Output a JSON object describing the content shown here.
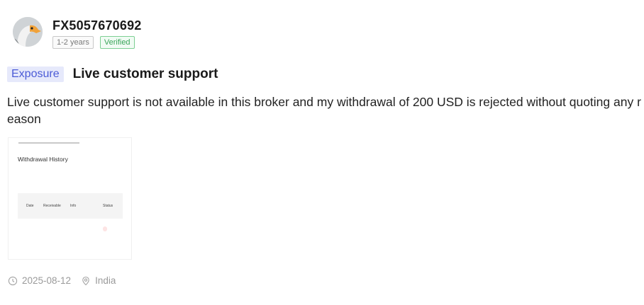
{
  "user": {
    "avatar_icon": "eagle-avatar-icon",
    "name": "FX5057670692",
    "experience_badge": "1-2 years",
    "verified_badge": "Verified"
  },
  "post": {
    "tag": "Exposure",
    "title": "Live customer support",
    "body": "Live customer support is not available in this broker and my withdrawal of 200 USD is rejected without quoting any reason"
  },
  "attachment": {
    "heading": "Withdrawal History",
    "columns": [
      "",
      "Date",
      "Receivable",
      "Info",
      "Status"
    ],
    "row": [
      "",
      "",
      "",
      "",
      ""
    ]
  },
  "meta": {
    "date": "2025-08-12",
    "location": "India",
    "date_icon": "clock-icon",
    "location_icon": "location-pin-icon"
  },
  "colors": {
    "tag_bg": "#e6e9fb",
    "tag_text": "#4b5bd6",
    "verified": "#3aa55a"
  }
}
